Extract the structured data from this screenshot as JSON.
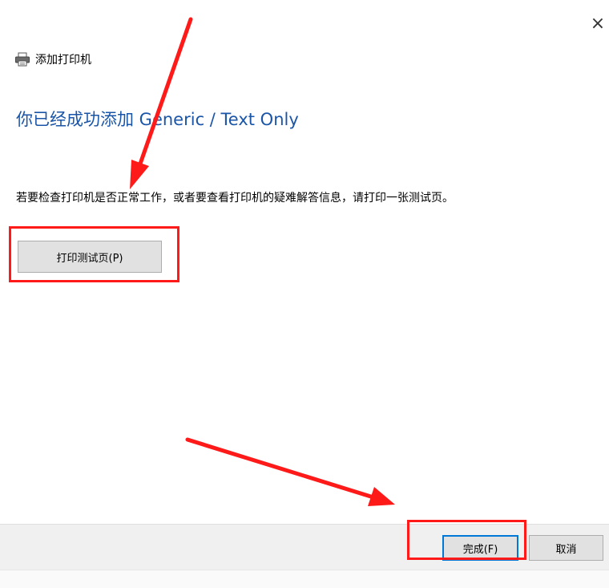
{
  "window": {
    "title": "添加打印机",
    "close_glyph": "×",
    "icon": "printer-icon"
  },
  "main": {
    "heading": "你已经成功添加 Generic / Text Only",
    "instruction": "若要检查打印机是否正常工作，或者要查看打印机的疑难解答信息，请打印一张测试页。",
    "test_page_button": "打印测试页(P)"
  },
  "footer": {
    "finish_button": "完成(F)",
    "cancel_button": "取消"
  },
  "annotations": {
    "color": "#ff1a1a"
  }
}
